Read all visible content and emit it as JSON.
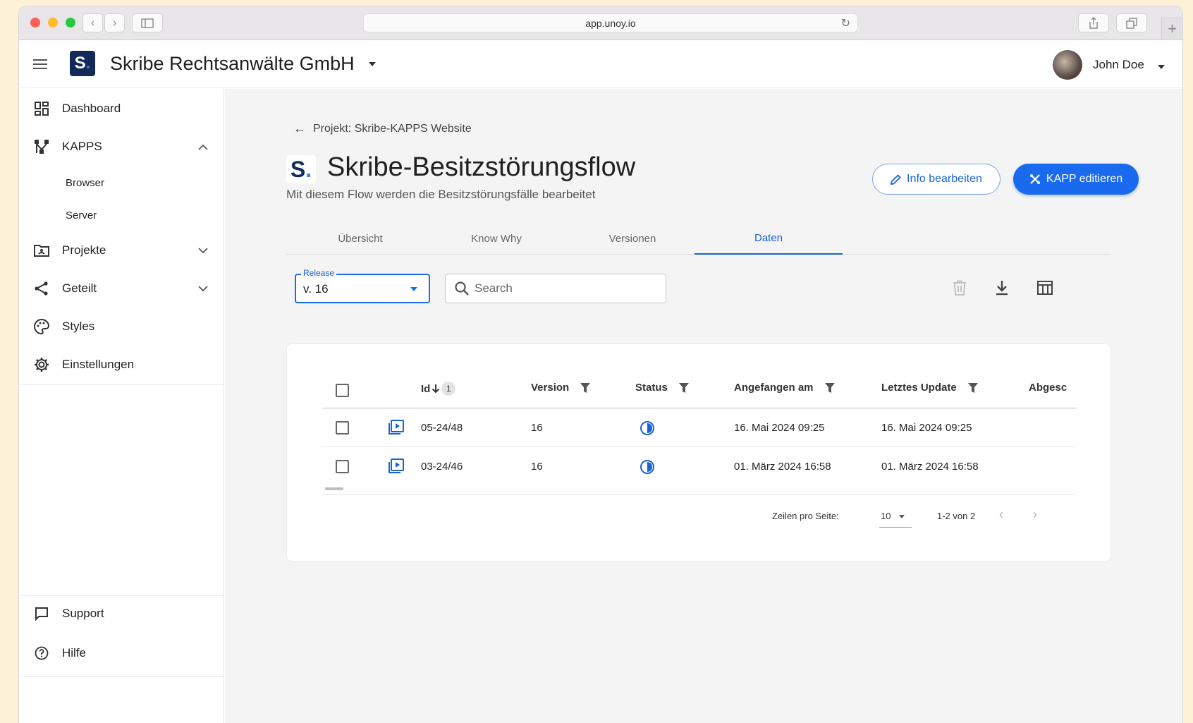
{
  "browser": {
    "url": "app.unoy.io"
  },
  "header": {
    "org_logo_letter": "S",
    "org_logo_dot": ".",
    "org_name": "Skribe Rechtsanwälte GmbH",
    "user_name": "John Doe"
  },
  "sidebar": {
    "items": [
      {
        "label": "Dashboard",
        "icon": "dashboard-icon"
      },
      {
        "label": "KAPPS",
        "icon": "kapps-icon",
        "expanded": true
      },
      {
        "label": "Projekte",
        "icon": "folder-icon"
      },
      {
        "label": "Geteilt",
        "icon": "share-icon"
      },
      {
        "label": "Styles",
        "icon": "palette-icon"
      },
      {
        "label": "Einstellungen",
        "icon": "gear-icon"
      }
    ],
    "subitems": [
      "Browser",
      "Server"
    ],
    "bottom": [
      {
        "label": "Support",
        "icon": "chat-icon"
      },
      {
        "label": "Hilfe",
        "icon": "help-icon"
      }
    ]
  },
  "page": {
    "breadcrumb": "Projekt: Skribe-KAPPS Website",
    "logo_letter": "S",
    "logo_dot": ".",
    "title": "Skribe-Besitzstörungsflow",
    "subtitle": "Mit diesem Flow werden die Besitzstörungsfälle bearbeitet",
    "edit_info_label": "Info bearbeiten",
    "edit_kapp_label": "KAPP editieren",
    "accent_color": "#1a6af0"
  },
  "tabs": [
    "Übersicht",
    "Know Why",
    "Versionen",
    "Daten"
  ],
  "active_tab": "Daten",
  "filters": {
    "release_label": "Release",
    "release_value": "v. 16",
    "search_placeholder": "Search"
  },
  "table": {
    "columns": {
      "id": "Id",
      "id_sort_badge": "1",
      "version": "Version",
      "status": "Status",
      "started": "Angefangen am",
      "updated": "Letztes Update",
      "completed": "Abgesc"
    },
    "rows": [
      {
        "id": "05-24/48",
        "version": "16",
        "started": "16. Mai 2024 09:25",
        "updated": "16. Mai 2024 09:25"
      },
      {
        "id": "03-24/46",
        "version": "16",
        "started": "01. März 2024 16:58",
        "updated": "01. März 2024 16:58"
      }
    ]
  },
  "pagination": {
    "rows_per_page_label": "Zeilen pro Seite:",
    "rows_per_page": "10",
    "range": "1-2 von 2"
  }
}
